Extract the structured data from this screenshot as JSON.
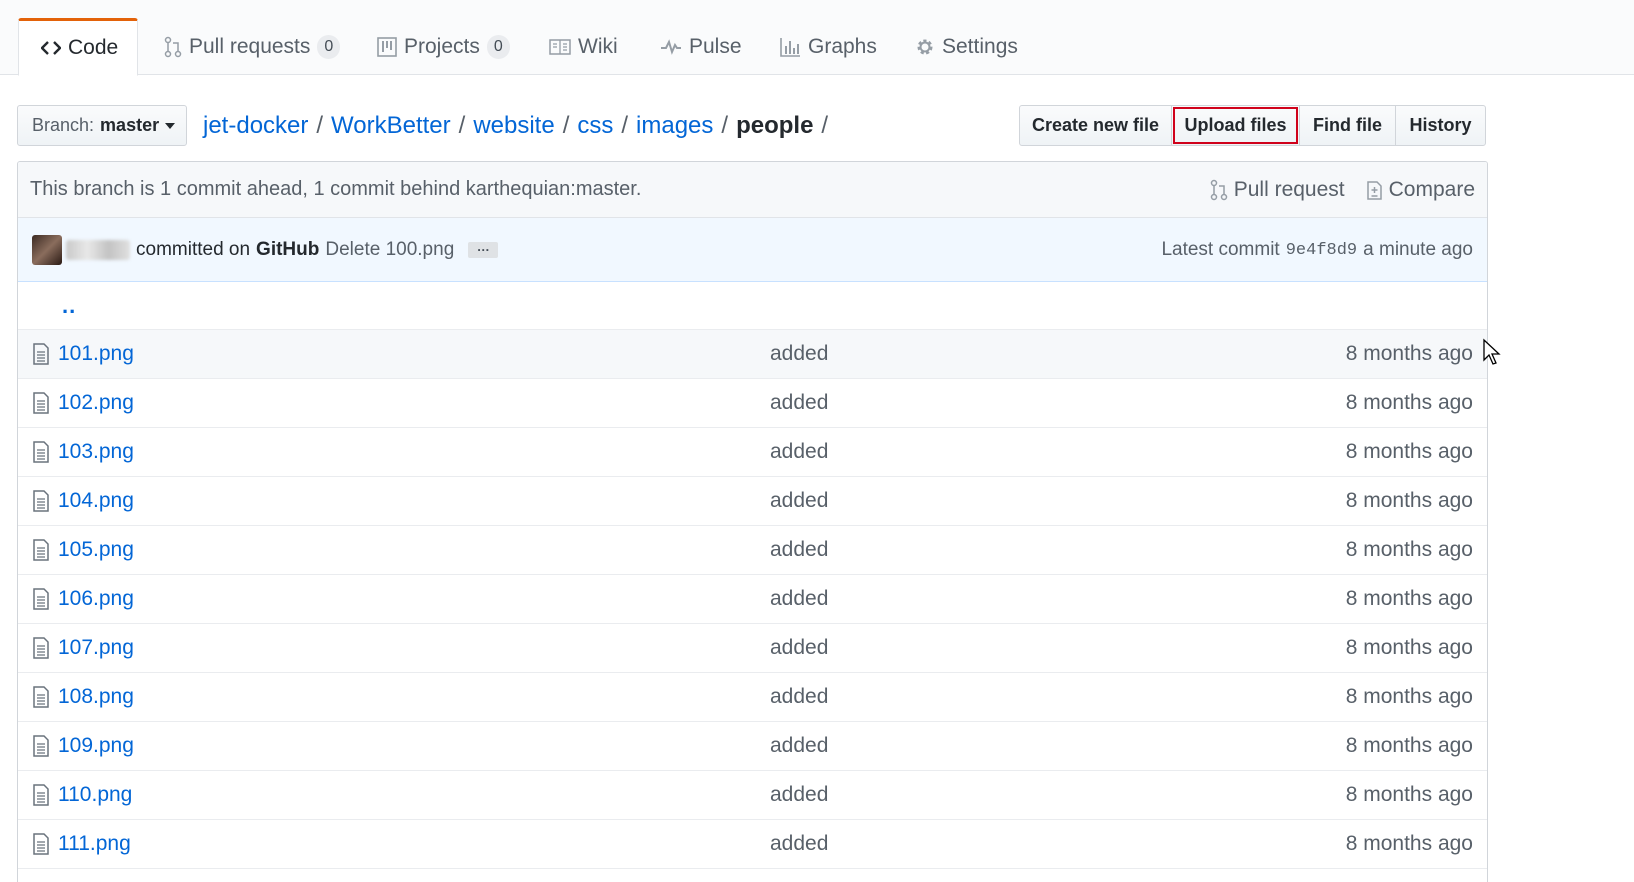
{
  "tabs": [
    {
      "label": "Code",
      "icon": "code-icon",
      "selected": true
    },
    {
      "label": "Pull requests",
      "icon": "git-pull-request-icon",
      "count": "0"
    },
    {
      "label": "Projects",
      "icon": "project-icon",
      "count": "0"
    },
    {
      "label": "Wiki",
      "icon": "book-icon"
    },
    {
      "label": "Pulse",
      "icon": "pulse-icon"
    },
    {
      "label": "Graphs",
      "icon": "graph-icon"
    },
    {
      "label": "Settings",
      "icon": "gear-icon"
    }
  ],
  "branch": {
    "prefix": "Branch:",
    "name": "master"
  },
  "breadcrumb": {
    "parts": [
      "jet-docker",
      "WorkBetter",
      "website",
      "css",
      "images"
    ],
    "current": "people",
    "separator": "/"
  },
  "actions": {
    "create": "Create new file",
    "upload": "Upload files",
    "find": "Find file",
    "history": "History"
  },
  "ahead_bar": {
    "text": "This branch is 1 commit ahead, 1 commit behind karthequian:master.",
    "pull_request": "Pull request",
    "compare": "Compare"
  },
  "commit": {
    "committed_on": "committed on",
    "platform": "GitHub",
    "message": "Delete 100.png",
    "ellipsis": "…",
    "latest_label": "Latest commit",
    "sha": "9e4f8d9",
    "age": "a minute ago"
  },
  "up_dir": "..",
  "files": [
    {
      "name": "101.png",
      "message": "added",
      "age": "8 months ago"
    },
    {
      "name": "102.png",
      "message": "added",
      "age": "8 months ago"
    },
    {
      "name": "103.png",
      "message": "added",
      "age": "8 months ago"
    },
    {
      "name": "104.png",
      "message": "added",
      "age": "8 months ago"
    },
    {
      "name": "105.png",
      "message": "added",
      "age": "8 months ago"
    },
    {
      "name": "106.png",
      "message": "added",
      "age": "8 months ago"
    },
    {
      "name": "107.png",
      "message": "added",
      "age": "8 months ago"
    },
    {
      "name": "108.png",
      "message": "added",
      "age": "8 months ago"
    },
    {
      "name": "109.png",
      "message": "added",
      "age": "8 months ago"
    },
    {
      "name": "110.png",
      "message": "added",
      "age": "8 months ago"
    },
    {
      "name": "111.png",
      "message": "added",
      "age": "8 months ago"
    }
  ],
  "colors": {
    "link": "#0366d6",
    "selected_tab_accent": "#e36209",
    "highlight_box": "#d0021b"
  }
}
